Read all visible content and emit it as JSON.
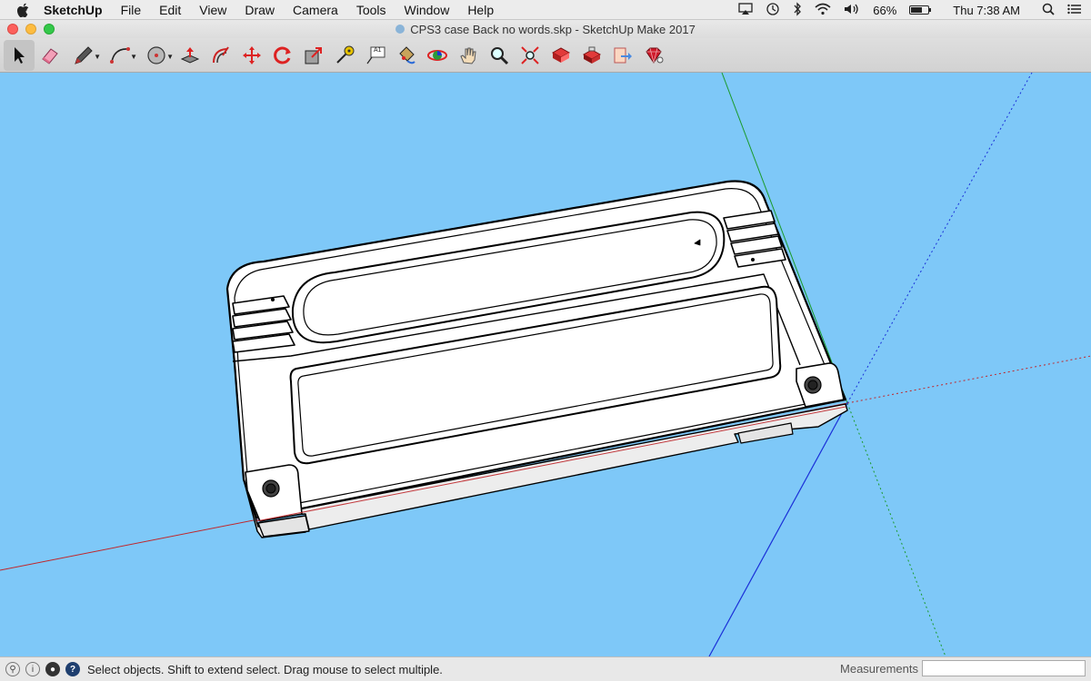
{
  "menubar": {
    "app_name": "SketchUp",
    "items": [
      "File",
      "Edit",
      "View",
      "Draw",
      "Camera",
      "Tools",
      "Window",
      "Help"
    ],
    "battery_percent": "66%",
    "clock": "Thu 7:38 AM"
  },
  "window": {
    "title": "CPS3 case Back no words.skp - SketchUp Make 2017"
  },
  "toolbar": {
    "tools": [
      {
        "name": "select-tool",
        "icon": "arrow-cursor-icon"
      },
      {
        "name": "eraser-tool",
        "icon": "eraser-icon"
      },
      {
        "name": "line-tool",
        "icon": "pencil-icon"
      },
      {
        "name": "arc-tool",
        "icon": "arc-icon"
      },
      {
        "name": "shapes-tool",
        "icon": "circle-shape-icon"
      },
      {
        "name": "push-pull-tool",
        "icon": "push-pull-icon"
      },
      {
        "name": "offset-tool",
        "icon": "offset-icon"
      },
      {
        "name": "move-tool",
        "icon": "move-arrows-icon"
      },
      {
        "name": "rotate-tool",
        "icon": "rotate-icon"
      },
      {
        "name": "scale-tool",
        "icon": "scale-icon"
      },
      {
        "name": "tape-measure-tool",
        "icon": "tape-measure-icon"
      },
      {
        "name": "text-tool",
        "icon": "text-icon"
      },
      {
        "name": "paint-bucket-tool",
        "icon": "paint-bucket-icon"
      },
      {
        "name": "orbit-tool",
        "icon": "orbit-icon"
      },
      {
        "name": "pan-tool",
        "icon": "hand-icon"
      },
      {
        "name": "zoom-tool",
        "icon": "magnifier-icon"
      },
      {
        "name": "zoom-extents-tool",
        "icon": "zoom-extents-icon"
      },
      {
        "name": "warehouse-tool",
        "icon": "3d-warehouse-icon"
      },
      {
        "name": "extension-warehouse-tool",
        "icon": "extension-warehouse-icon"
      },
      {
        "name": "share-model-tool",
        "icon": "share-model-icon"
      },
      {
        "name": "extension-manager-tool",
        "icon": "ruby-gem-icon"
      }
    ],
    "text_tool_label": "A1"
  },
  "statusbar": {
    "message": "Select objects. Shift to extend select. Drag mouse to select multiple.",
    "measurements_label": "Measurements",
    "measurements_value": ""
  },
  "colors": {
    "sky": "#7ec8f8",
    "red_axis": "#c0262a",
    "green_axis": "#1a9a2a",
    "blue_axis": "#1a2fd8",
    "model_fill": "#ffffff",
    "model_edge": "#000000"
  }
}
